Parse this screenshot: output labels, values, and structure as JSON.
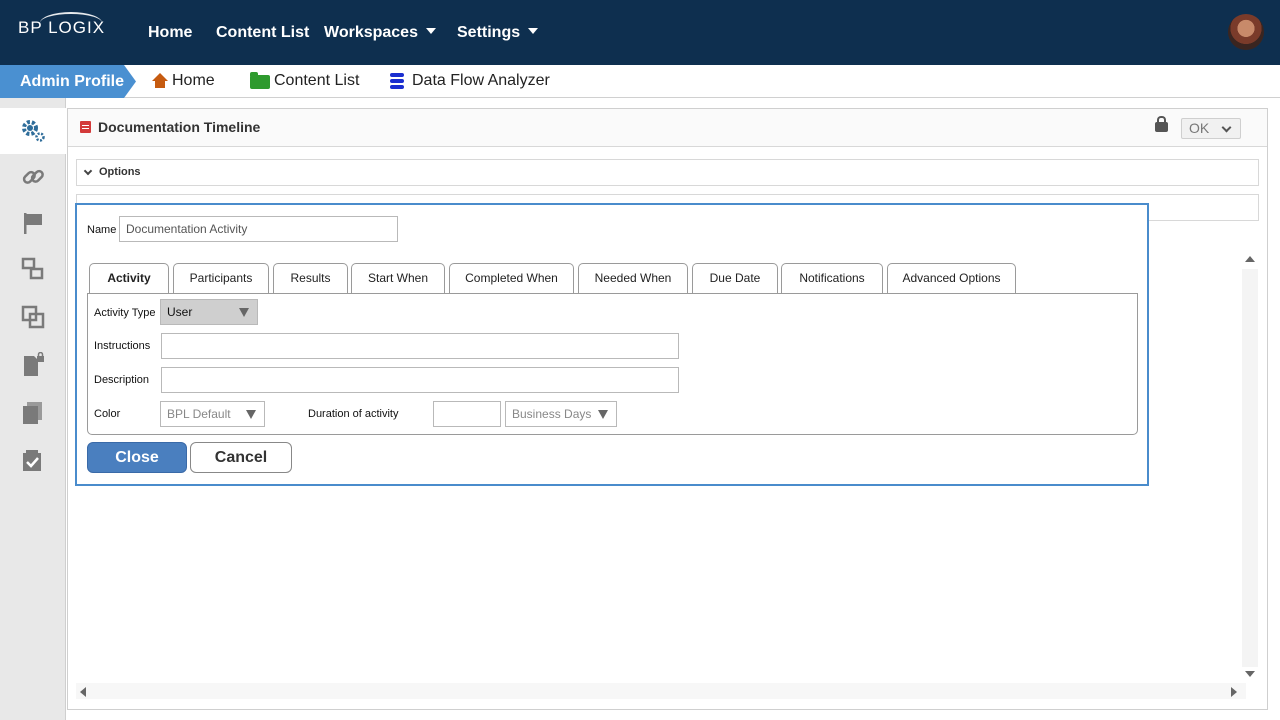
{
  "topnav": {
    "logo": "BP LOGIX",
    "items": [
      {
        "label": "Home"
      },
      {
        "label": "Content List"
      },
      {
        "label": "Workspaces"
      },
      {
        "label": "Settings"
      }
    ]
  },
  "breadcrumb": {
    "admin_label": "Admin Profile",
    "home_label": "Home",
    "content_list_label": "Content List",
    "data_flow_label": "Data Flow Analyzer"
  },
  "sidebar": {
    "icons": [
      "gears-icon",
      "link-icon",
      "flag-icon",
      "process-icon",
      "copy-icon",
      "locked-document-icon",
      "documents-icon",
      "checklist-icon"
    ]
  },
  "panel": {
    "title": "Documentation Timeline",
    "ok_label": "OK",
    "options_label": "Options"
  },
  "dialog": {
    "name_label": "Name",
    "name_value": "Documentation Activity",
    "tabs": [
      {
        "label": "Activity"
      },
      {
        "label": "Participants"
      },
      {
        "label": "Results"
      },
      {
        "label": "Start When"
      },
      {
        "label": "Completed When"
      },
      {
        "label": "Needed When"
      },
      {
        "label": "Due Date"
      },
      {
        "label": "Notifications"
      },
      {
        "label": "Advanced Options"
      }
    ],
    "activity_type_label": "Activity Type",
    "activity_type_value": "User",
    "instructions_label": "Instructions",
    "instructions_value": "",
    "description_label": "Description",
    "description_value": "",
    "color_label": "Color",
    "color_value": "BPL Default",
    "duration_label": "Duration of activity",
    "duration_value": "",
    "duration_unit": "Business Days",
    "close_label": "Close",
    "cancel_label": "Cancel"
  },
  "colors": {
    "nav_bg": "#0e2f4f",
    "admin_bg": "#4a90d1",
    "dialog_border": "#4a8ccc",
    "close_button": "#4a7fbf"
  }
}
